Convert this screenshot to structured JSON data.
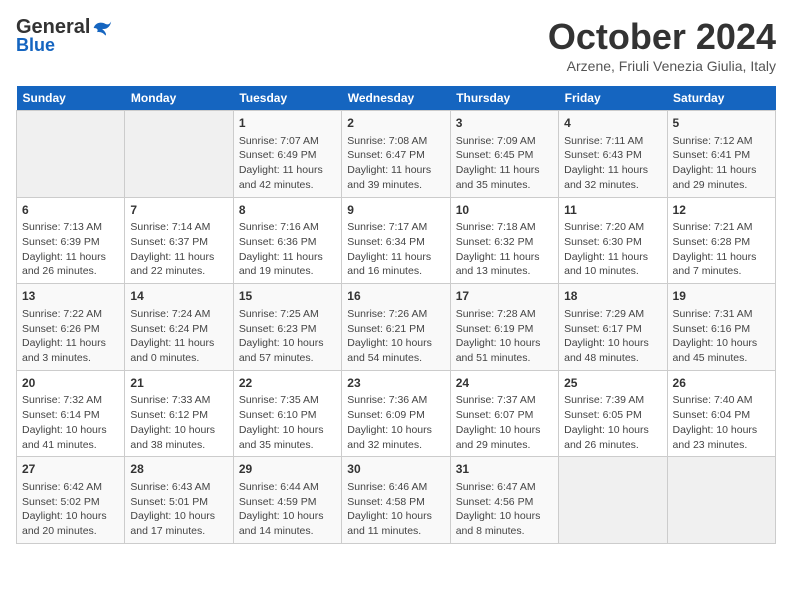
{
  "logo": {
    "general": "General",
    "blue": "Blue"
  },
  "title": "October 2024",
  "location": "Arzene, Friuli Venezia Giulia, Italy",
  "headers": [
    "Sunday",
    "Monday",
    "Tuesday",
    "Wednesday",
    "Thursday",
    "Friday",
    "Saturday"
  ],
  "rows": [
    [
      {
        "day": "",
        "content": ""
      },
      {
        "day": "",
        "content": ""
      },
      {
        "day": "1",
        "content": "Sunrise: 7:07 AM\nSunset: 6:49 PM\nDaylight: 11 hours and 42 minutes."
      },
      {
        "day": "2",
        "content": "Sunrise: 7:08 AM\nSunset: 6:47 PM\nDaylight: 11 hours and 39 minutes."
      },
      {
        "day": "3",
        "content": "Sunrise: 7:09 AM\nSunset: 6:45 PM\nDaylight: 11 hours and 35 minutes."
      },
      {
        "day": "4",
        "content": "Sunrise: 7:11 AM\nSunset: 6:43 PM\nDaylight: 11 hours and 32 minutes."
      },
      {
        "day": "5",
        "content": "Sunrise: 7:12 AM\nSunset: 6:41 PM\nDaylight: 11 hours and 29 minutes."
      }
    ],
    [
      {
        "day": "6",
        "content": "Sunrise: 7:13 AM\nSunset: 6:39 PM\nDaylight: 11 hours and 26 minutes."
      },
      {
        "day": "7",
        "content": "Sunrise: 7:14 AM\nSunset: 6:37 PM\nDaylight: 11 hours and 22 minutes."
      },
      {
        "day": "8",
        "content": "Sunrise: 7:16 AM\nSunset: 6:36 PM\nDaylight: 11 hours and 19 minutes."
      },
      {
        "day": "9",
        "content": "Sunrise: 7:17 AM\nSunset: 6:34 PM\nDaylight: 11 hours and 16 minutes."
      },
      {
        "day": "10",
        "content": "Sunrise: 7:18 AM\nSunset: 6:32 PM\nDaylight: 11 hours and 13 minutes."
      },
      {
        "day": "11",
        "content": "Sunrise: 7:20 AM\nSunset: 6:30 PM\nDaylight: 11 hours and 10 minutes."
      },
      {
        "day": "12",
        "content": "Sunrise: 7:21 AM\nSunset: 6:28 PM\nDaylight: 11 hours and 7 minutes."
      }
    ],
    [
      {
        "day": "13",
        "content": "Sunrise: 7:22 AM\nSunset: 6:26 PM\nDaylight: 11 hours and 3 minutes."
      },
      {
        "day": "14",
        "content": "Sunrise: 7:24 AM\nSunset: 6:24 PM\nDaylight: 11 hours and 0 minutes."
      },
      {
        "day": "15",
        "content": "Sunrise: 7:25 AM\nSunset: 6:23 PM\nDaylight: 10 hours and 57 minutes."
      },
      {
        "day": "16",
        "content": "Sunrise: 7:26 AM\nSunset: 6:21 PM\nDaylight: 10 hours and 54 minutes."
      },
      {
        "day": "17",
        "content": "Sunrise: 7:28 AM\nSunset: 6:19 PM\nDaylight: 10 hours and 51 minutes."
      },
      {
        "day": "18",
        "content": "Sunrise: 7:29 AM\nSunset: 6:17 PM\nDaylight: 10 hours and 48 minutes."
      },
      {
        "day": "19",
        "content": "Sunrise: 7:31 AM\nSunset: 6:16 PM\nDaylight: 10 hours and 45 minutes."
      }
    ],
    [
      {
        "day": "20",
        "content": "Sunrise: 7:32 AM\nSunset: 6:14 PM\nDaylight: 10 hours and 41 minutes."
      },
      {
        "day": "21",
        "content": "Sunrise: 7:33 AM\nSunset: 6:12 PM\nDaylight: 10 hours and 38 minutes."
      },
      {
        "day": "22",
        "content": "Sunrise: 7:35 AM\nSunset: 6:10 PM\nDaylight: 10 hours and 35 minutes."
      },
      {
        "day": "23",
        "content": "Sunrise: 7:36 AM\nSunset: 6:09 PM\nDaylight: 10 hours and 32 minutes."
      },
      {
        "day": "24",
        "content": "Sunrise: 7:37 AM\nSunset: 6:07 PM\nDaylight: 10 hours and 29 minutes."
      },
      {
        "day": "25",
        "content": "Sunrise: 7:39 AM\nSunset: 6:05 PM\nDaylight: 10 hours and 26 minutes."
      },
      {
        "day": "26",
        "content": "Sunrise: 7:40 AM\nSunset: 6:04 PM\nDaylight: 10 hours and 23 minutes."
      }
    ],
    [
      {
        "day": "27",
        "content": "Sunrise: 6:42 AM\nSunset: 5:02 PM\nDaylight: 10 hours and 20 minutes."
      },
      {
        "day": "28",
        "content": "Sunrise: 6:43 AM\nSunset: 5:01 PM\nDaylight: 10 hours and 17 minutes."
      },
      {
        "day": "29",
        "content": "Sunrise: 6:44 AM\nSunset: 4:59 PM\nDaylight: 10 hours and 14 minutes."
      },
      {
        "day": "30",
        "content": "Sunrise: 6:46 AM\nSunset: 4:58 PM\nDaylight: 10 hours and 11 minutes."
      },
      {
        "day": "31",
        "content": "Sunrise: 6:47 AM\nSunset: 4:56 PM\nDaylight: 10 hours and 8 minutes."
      },
      {
        "day": "",
        "content": ""
      },
      {
        "day": "",
        "content": ""
      }
    ]
  ]
}
